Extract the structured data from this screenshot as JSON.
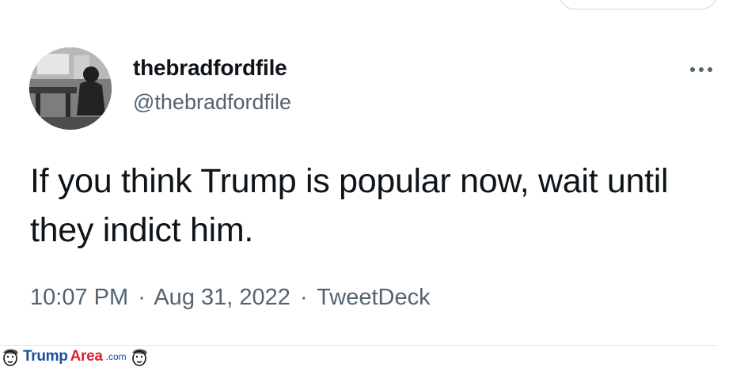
{
  "author": {
    "display_name": "thebradfordfile",
    "handle": "@thebradfordfile",
    "avatar_icon": "profile-photo"
  },
  "tweet": {
    "text": "If you think Trump is popular now, wait until they indict him.",
    "time": "10:07 PM",
    "date": "Aug 31, 2022",
    "source": "TweetDeck",
    "separator": "·"
  },
  "more_button_icon": "more-horizontal-icon",
  "watermark": {
    "brand_part1": "Trump",
    "brand_part2": "Area",
    "suffix": ".com",
    "colors": {
      "blue": "#1b4ea1",
      "red": "#d8262f"
    }
  },
  "colors": {
    "text_primary": "#0f1419",
    "text_secondary": "#536471",
    "border": "#cfd9de"
  }
}
